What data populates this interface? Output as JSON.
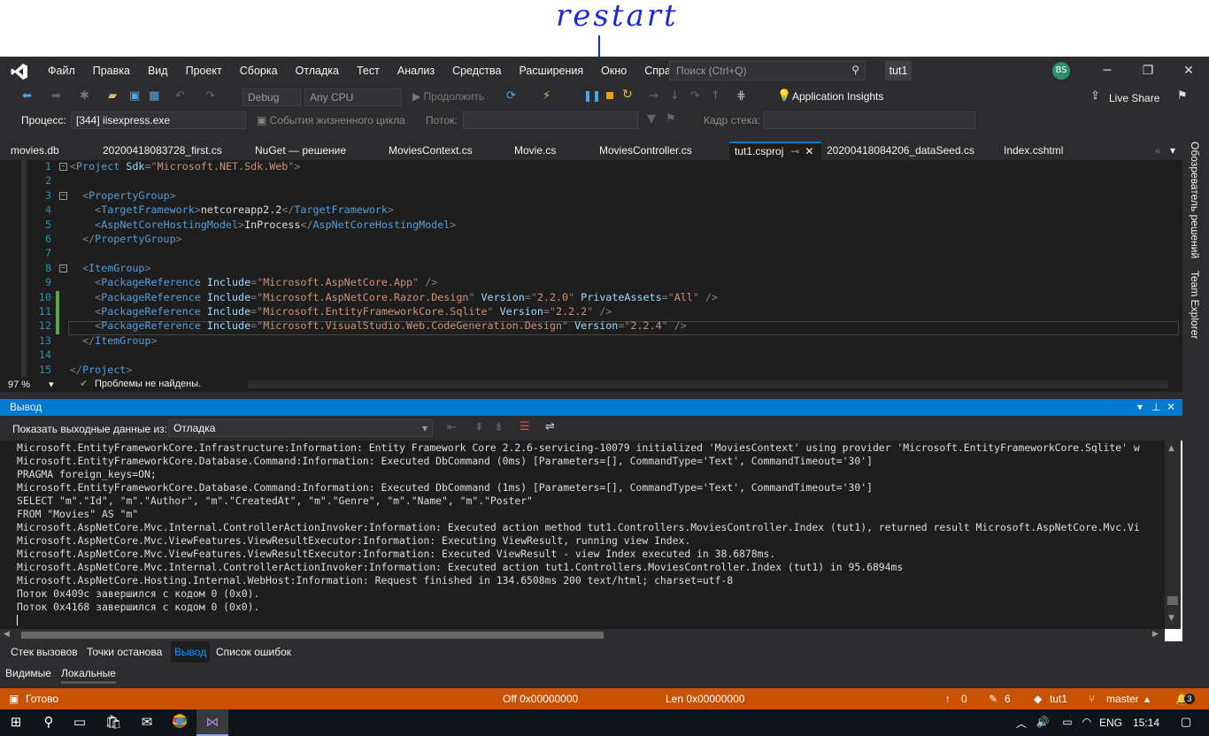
{
  "annotation": {
    "text": "restart"
  },
  "menu": {
    "items": [
      "Файл",
      "Правка",
      "Вид",
      "Проект",
      "Сборка",
      "Отладка",
      "Тест",
      "Анализ",
      "Средства",
      "Расширения",
      "Окно",
      "Справка"
    ],
    "search_placeholder": "Поиск (Ctrl+Q)",
    "solution_name": "tut1",
    "avatar": "BS"
  },
  "toolbar1": {
    "config": "Debug",
    "platform": "Any CPU",
    "continue_label": "Продолжить",
    "app_insights": "Application Insights",
    "live_share": "Live Share"
  },
  "toolbar2": {
    "process_label": "Процесс:",
    "process_value": "[344] iisexpress.exe",
    "lifecycle_label": "События жизненного цикла",
    "thread_label": "Поток:",
    "stackframe_label": "Кадр стека:"
  },
  "tabs": [
    "movies.db",
    "20200418083728_first.cs",
    "NuGet — решение",
    "MoviesContext.cs",
    "Movie.cs",
    "MoviesController.cs",
    "tut1.csproj",
    "20200418084206_dataSeed.cs",
    "Index.cshtml"
  ],
  "editor": {
    "lines": [
      {
        "n": "1",
        "code": "<Project Sdk=\"Microsoft.NET.Sdk.Web\">"
      },
      {
        "n": "2",
        "code": ""
      },
      {
        "n": "3",
        "code": "  <PropertyGroup>"
      },
      {
        "n": "4",
        "code": "    <TargetFramework>netcoreapp2.2</TargetFramework>"
      },
      {
        "n": "5",
        "code": "    <AspNetCoreHostingModel>InProcess</AspNetCoreHostingModel>"
      },
      {
        "n": "6",
        "code": "  </PropertyGroup>"
      },
      {
        "n": "7",
        "code": ""
      },
      {
        "n": "8",
        "code": "  <ItemGroup>"
      },
      {
        "n": "9",
        "code": "    <PackageReference Include=\"Microsoft.AspNetCore.App\" />"
      },
      {
        "n": "10",
        "code": "    <PackageReference Include=\"Microsoft.AspNetCore.Razor.Design\" Version=\"2.2.0\" PrivateAssets=\"All\" />"
      },
      {
        "n": "11",
        "code": "    <PackageReference Include=\"Microsoft.EntityFrameworkCore.Sqlite\" Version=\"2.2.2\" />"
      },
      {
        "n": "12",
        "code": "    <PackageReference Include=\"Microsoft.VisualStudio.Web.CodeGeneration.Design\" Version=\"2.2.4\" />"
      },
      {
        "n": "13",
        "code": "  </ItemGroup>"
      },
      {
        "n": "14",
        "code": ""
      },
      {
        "n": "15",
        "code": "</Project>"
      }
    ],
    "zoom": "97 %",
    "issues": "Проблемы не найдены."
  },
  "right_panel": {
    "solution_explorer": "Обозреватель решений",
    "team_explorer": "Team Explorer"
  },
  "output": {
    "title": "Вывод",
    "show_from_label": "Показать выходные данные из:",
    "show_from_value": "Отладка",
    "lines": [
      "Microsoft.EntityFrameworkCore.Infrastructure:Information: Entity Framework Core 2.2.6-servicing-10079 initialized 'MoviesContext' using provider 'Microsoft.EntityFrameworkCore.Sqlite' w",
      "Microsoft.EntityFrameworkCore.Database.Command:Information: Executed DbCommand (0ms) [Parameters=[], CommandType='Text', CommandTimeout='30']",
      "PRAGMA foreign_keys=ON;",
      "Microsoft.EntityFrameworkCore.Database.Command:Information: Executed DbCommand (1ms) [Parameters=[], CommandType='Text', CommandTimeout='30']",
      "SELECT \"m\".\"Id\", \"m\".\"Author\", \"m\".\"CreatedAt\", \"m\".\"Genre\", \"m\".\"Name\", \"m\".\"Poster\"",
      "FROM \"Movies\" AS \"m\"",
      "Microsoft.AspNetCore.Mvc.Internal.ControllerActionInvoker:Information: Executed action method tut1.Controllers.MoviesController.Index (tut1), returned result Microsoft.AspNetCore.Mvc.Vi",
      "Microsoft.AspNetCore.Mvc.ViewFeatures.ViewResultExecutor:Information: Executing ViewResult, running view Index.",
      "Microsoft.AspNetCore.Mvc.ViewFeatures.ViewResultExecutor:Information: Executed ViewResult - view Index executed in 38.6878ms.",
      "Microsoft.AspNetCore.Mvc.Internal.ControllerActionInvoker:Information: Executed action tut1.Controllers.MoviesController.Index (tut1) in 95.6894ms",
      "Microsoft.AspNetCore.Hosting.Internal.WebHost:Information: Request finished in 134.6508ms 200 text/html; charset=utf-8",
      "Поток 0x409c завершился с кодом 0 (0x0).",
      "Поток 0x4168 завершился с кодом 0 (0x0)."
    ]
  },
  "bottom_tabs": [
    "Стек вызовов",
    "Точки останова",
    "Вывод",
    "Список ошибок"
  ],
  "bottom_tabs2": [
    "Видимые",
    "Локальные"
  ],
  "status": {
    "ready": "Готово",
    "off": "Off 0x00000000",
    "len": "Len 0x00000000",
    "up": "0",
    "edits": "6",
    "repo": "tut1",
    "branch": "master",
    "notifications": "3"
  },
  "taskbar": {
    "lang": "ENG",
    "time": "15:14"
  }
}
